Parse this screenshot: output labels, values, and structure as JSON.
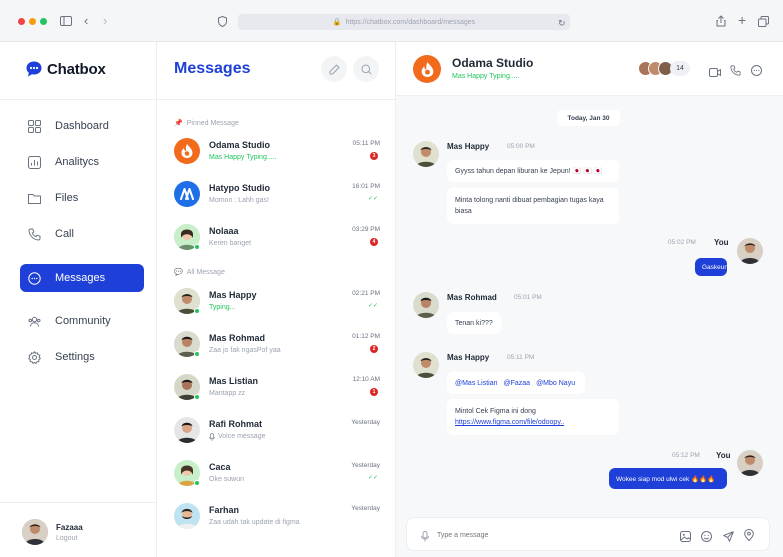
{
  "browser": {
    "url": "https://chatbox.com/dashboard/messages"
  },
  "app": {
    "logo_text": "Chatbox"
  },
  "sidebar": {
    "items": [
      {
        "label": "Dashboard",
        "icon": "grid-icon"
      },
      {
        "label": "Analitycs",
        "icon": "chart-icon"
      },
      {
        "label": "Files",
        "icon": "folder-icon"
      },
      {
        "label": "Call",
        "icon": "phone-icon"
      },
      {
        "label": "Messages",
        "icon": "chat-icon",
        "active": true
      },
      {
        "label": "Community",
        "icon": "users-icon"
      },
      {
        "label": "Settings",
        "icon": "gear-icon"
      }
    ],
    "user": {
      "name": "Fazaaa",
      "action": "Logout"
    }
  },
  "list": {
    "title": "Messages",
    "pinned_label": "Pinned Message",
    "all_label": "All Message",
    "pinned": [
      {
        "name": "Odama Studio",
        "preview": "Mas Happy Typing.....",
        "time": "05:11 PM",
        "badge": "3",
        "typing": true
      },
      {
        "name": "Hatypo Studio",
        "preview": "Momon : Lahh gas!",
        "time": "16:01 PM",
        "check": "✓✓"
      },
      {
        "name": "Nolaaa",
        "preview": "Keren banget",
        "time": "03:29 PM",
        "badge": "4"
      }
    ],
    "all": [
      {
        "name": "Mas Happy",
        "preview": "Typing...",
        "time": "02:21 PM",
        "check": "✓✓",
        "typing": true
      },
      {
        "name": "Mas Rohmad",
        "preview": "Zaa jo fak ngasPof yaa",
        "time": "01:12 PM",
        "badge": "2"
      },
      {
        "name": "Mas Listian",
        "preview": "Mantapp zz",
        "time": "12:10 AM",
        "badge": "1"
      },
      {
        "name": "Rafi Rohmat",
        "preview": "Voice message",
        "time": "Yesterday"
      },
      {
        "name": "Caca",
        "preview": "Oke suwun",
        "time": "Yesterday",
        "check": "✓✓"
      },
      {
        "name": "Farhan",
        "preview": "Zaa udah tak update di figma",
        "time": "Yesterday"
      }
    ]
  },
  "chat": {
    "title": "Odama Studio",
    "status": "Mas Happy Typing.....",
    "members_count": "14",
    "date_chip": "Today, Jan 30",
    "messages": [
      {
        "sender": "Mas Happy",
        "time": "05:00 PM",
        "texts": [
          "Gyyss tahun depan liburan ke Jepun! 🇯🇵 🇯🇵 🇯🇵",
          "Minta tolong nanti dibuat pembagian tugas kaya biasa"
        ]
      },
      {
        "sender": "You",
        "time": "05:02 PM",
        "texts": [
          "Gaskeun"
        ]
      },
      {
        "sender": "Mas Rohmad",
        "time": "05:01 PM",
        "texts": [
          "Tenan ki???"
        ]
      },
      {
        "sender": "Mas Happy",
        "time": "05:11 PM",
        "mentions": [
          "@Mas Listian",
          "@Fazaa",
          "@Mbo Nayu"
        ],
        "text_prefix": "Mintol Cek Figma ini dong",
        "link": "https://www.figma.com/file/odoopy.."
      },
      {
        "sender": "You",
        "time": "05:12 PM",
        "texts": [
          "Wokee siap mod ulwi cek 🔥🔥🔥"
        ]
      }
    ],
    "input_placeholder": "Type a message"
  },
  "colors": {
    "accent": "#1e40d8",
    "brand_orange": "#f26b1d",
    "online": "#22c55e",
    "badge": "#dc2626"
  }
}
